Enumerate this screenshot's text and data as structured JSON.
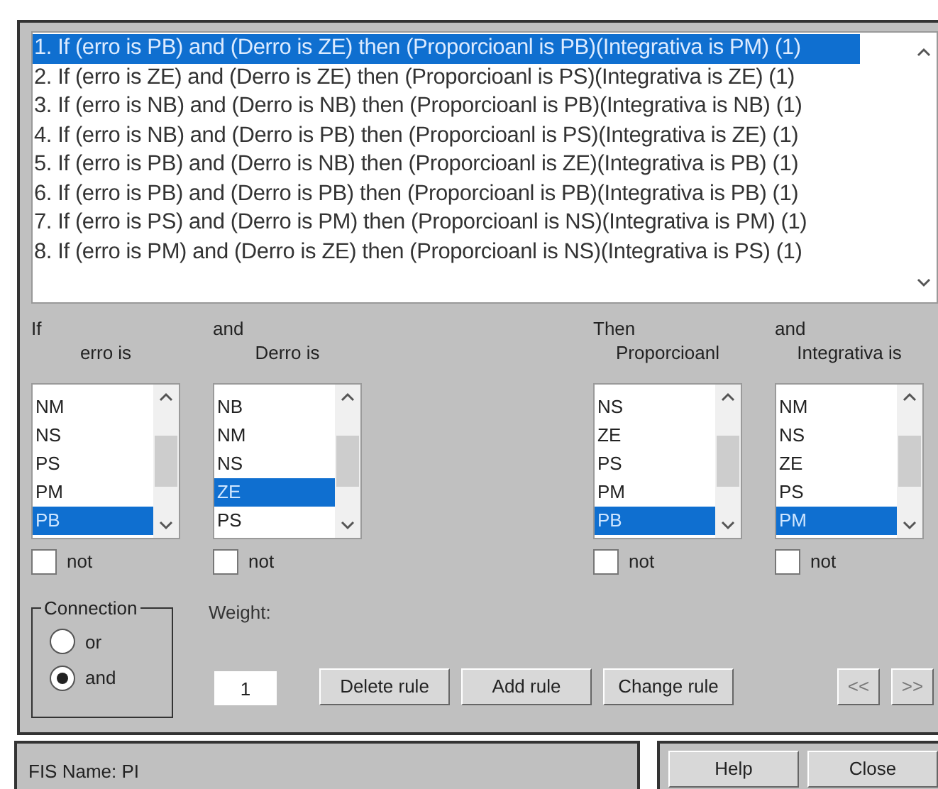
{
  "rules": [
    {
      "text": "1. If (erro is PB) and (Derro is ZE) then (Proporcioanl is PB)(Integrativa is PM) (1)",
      "selected": true
    },
    {
      "text": "2. If (erro is ZE) and (Derro is ZE) then (Proporcioanl is PS)(Integrativa is ZE) (1)",
      "selected": false
    },
    {
      "text": "3. If (erro is NB) and (Derro is NB) then (Proporcioanl is PB)(Integrativa is NB) (1)",
      "selected": false
    },
    {
      "text": "4. If (erro is NB) and (Derro is PB) then (Proporcioanl is PS)(Integrativa is ZE) (1)",
      "selected": false
    },
    {
      "text": "5. If (erro is PB) and (Derro is NB) then (Proporcioanl is ZE)(Integrativa is PB) (1)",
      "selected": false
    },
    {
      "text": "6. If (erro is PB) and (Derro is PB) then (Proporcioanl is PB)(Integrativa is PB) (1)",
      "selected": false
    },
    {
      "text": "7. If (erro is PS) and (Derro is PM) then (Proporcioanl is NS)(Integrativa is PM) (1)",
      "selected": false
    },
    {
      "text": "8. If (erro is PM) and (Derro is ZE) then (Proporcioanl is NS)(Integrativa is PS) (1)",
      "selected": false
    }
  ],
  "variables": [
    {
      "connective": "If",
      "name": "erro is",
      "items": [
        {
          "label": "NM",
          "selected": false
        },
        {
          "label": "NS",
          "selected": false
        },
        {
          "label": "PS",
          "selected": false
        },
        {
          "label": "PM",
          "selected": false
        },
        {
          "label": "PB",
          "selected": true
        }
      ],
      "not_label": "not",
      "not_checked": false
    },
    {
      "connective": "and",
      "name": "Derro is",
      "items": [
        {
          "label": "NB",
          "selected": false
        },
        {
          "label": "NM",
          "selected": false
        },
        {
          "label": "NS",
          "selected": false
        },
        {
          "label": "ZE",
          "selected": true
        },
        {
          "label": "PS",
          "selected": false
        }
      ],
      "not_label": "not",
      "not_checked": false
    },
    {
      "connective": "Then",
      "name": "Proporcioanl",
      "items": [
        {
          "label": "NS",
          "selected": false
        },
        {
          "label": "ZE",
          "selected": false
        },
        {
          "label": "PS",
          "selected": false
        },
        {
          "label": "PM",
          "selected": false
        },
        {
          "label": "PB",
          "selected": true
        }
      ],
      "not_label": "not",
      "not_checked": false
    },
    {
      "connective": "and",
      "name": "Integrativa is",
      "items": [
        {
          "label": "NM",
          "selected": false
        },
        {
          "label": "NS",
          "selected": false
        },
        {
          "label": "ZE",
          "selected": false
        },
        {
          "label": "PS",
          "selected": false
        },
        {
          "label": "PM",
          "selected": true
        }
      ],
      "not_label": "not",
      "not_checked": false
    }
  ],
  "connection": {
    "title": "Connection",
    "options": [
      {
        "label": "or",
        "selected": false
      },
      {
        "label": "and",
        "selected": true
      }
    ]
  },
  "weight": {
    "label": "Weight:",
    "value": "1"
  },
  "rule_buttons": [
    {
      "label": "Delete rule",
      "disabled": false
    },
    {
      "label": "Add rule",
      "disabled": false
    },
    {
      "label": "Change rule",
      "disabled": false
    }
  ],
  "nav_buttons": [
    {
      "label": "<<",
      "disabled": true
    },
    {
      "label": ">>",
      "disabled": true
    }
  ],
  "status": {
    "text": "FIS Name: PI"
  },
  "footer_buttons": [
    {
      "label": "Help"
    },
    {
      "label": "Close"
    }
  ]
}
